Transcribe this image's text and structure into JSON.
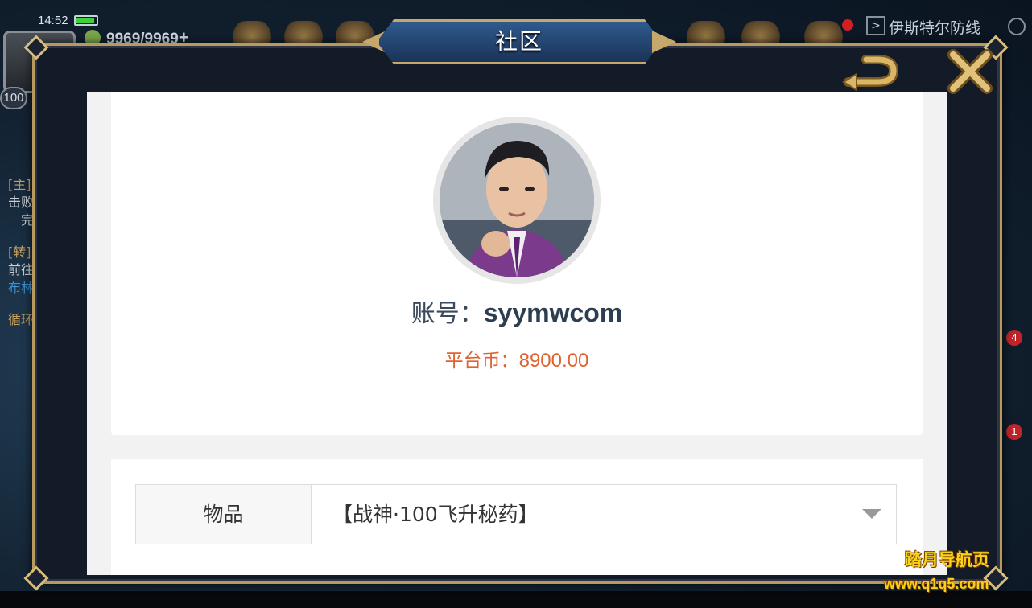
{
  "status_bar": {
    "time": "14:52"
  },
  "hud": {
    "level": "100",
    "stamina": "9969/9969",
    "stamina_plus": "+",
    "map_name": "伊斯特尔防线",
    "left_quest_tags": [
      "[主]",
      "击败",
      "完",
      "[转]",
      "前往",
      "布林",
      "循环"
    ],
    "right_badges": [
      "4",
      "1"
    ]
  },
  "modal": {
    "title": "社区",
    "back_icon": "back-arrow-icon",
    "close_icon": "close-x-icon"
  },
  "profile": {
    "account_label": "账号：",
    "account_value": "syymwcom",
    "coins_label": "平台币：",
    "coins_value": "8900.00"
  },
  "item_form": {
    "label": "物品",
    "selected": "【战神·100飞升秘药】"
  },
  "watermark": {
    "line1": "踏月导航页",
    "line2": "www.q1q5.com"
  },
  "colors": {
    "frame_gold": "#b79a5e",
    "title_blue": "#1a3358",
    "coins_orange": "#e0622e",
    "watermark_yellow": "#f6d21a"
  }
}
